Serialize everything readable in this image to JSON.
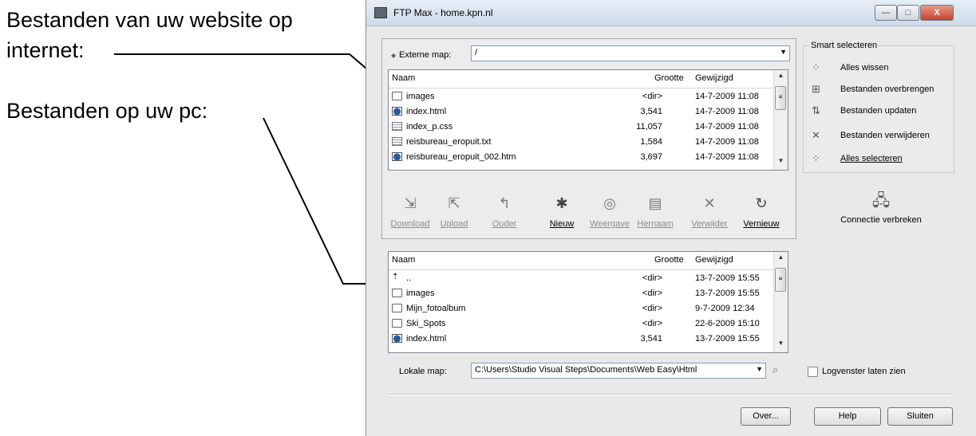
{
  "annotations": {
    "remote_line1": "Bestanden van uw website op",
    "remote_line2": "internet:",
    "local_label": "Bestanden op uw pc:"
  },
  "window": {
    "title": "FTP Max - home.kpn.nl",
    "minimize_glyph": "—",
    "maximize_glyph": "□",
    "close_glyph": "X"
  },
  "remote": {
    "map_label": "Externe map:",
    "map_value": "/",
    "columns": {
      "name": "Naam",
      "size": "Grootte",
      "modified": "Gewijzigd"
    },
    "files": [
      {
        "icon": "folder-icon",
        "name": "images",
        "size": "<dir>",
        "modified": "14-7-2009 11:08"
      },
      {
        "icon": "html-file-icon",
        "name": "index.html",
        "size": "3,541",
        "modified": "14-7-2009 11:08"
      },
      {
        "icon": "css-file-icon",
        "name": "index_p.css",
        "size": "11,057",
        "modified": "14-7-2009 11:08"
      },
      {
        "icon": "text-file-icon",
        "name": "reisbureau_eropuit.txt",
        "size": "1,584",
        "modified": "14-7-2009 11:08"
      },
      {
        "icon": "html-file-icon",
        "name": "reisbureau_eropuit_002.htm",
        "size": "3,697",
        "modified": "14-7-2009 11:08"
      }
    ]
  },
  "toolbar": {
    "download": "Download",
    "upload": "Upload",
    "parent": "Ouder",
    "new": "Nieuw",
    "view": "Weergave",
    "rename": "Hernaam",
    "delete": "Verwijder",
    "refresh": "Vernieuw"
  },
  "smart": {
    "title": "Smart selecteren",
    "items": [
      "Alles wissen",
      "Bestanden overbrengen",
      "Bestanden updaten",
      "Bestanden verwijderen",
      "Alles selecteren"
    ],
    "disconnect": "Connectie verbreken"
  },
  "local": {
    "columns": {
      "name": "Naam",
      "size": "Grootte",
      "modified": "Gewijzigd"
    },
    "files": [
      {
        "icon": "parent-folder-icon",
        "name": "..",
        "size": "<dir>",
        "modified": "13-7-2009 15:55"
      },
      {
        "icon": "folder-icon",
        "name": "images",
        "size": "<dir>",
        "modified": "13-7-2009 15:55"
      },
      {
        "icon": "folder-icon",
        "name": "Mijn_fotoalbum",
        "size": "<dir>",
        "modified": "9-7-2009 12:34"
      },
      {
        "icon": "folder-icon",
        "name": "Ski_Spots",
        "size": "<dir>",
        "modified": "22-6-2009 15:10"
      },
      {
        "icon": "html-file-icon",
        "name": "index.html",
        "size": "3,541",
        "modified": "13-7-2009 15:55"
      }
    ],
    "map_label": "Lokale map:",
    "map_value": "C:\\Users\\Studio Visual Steps\\Documents\\Web Easy\\Html"
  },
  "log_checkbox_label": "Logvenster laten zien",
  "buttons": {
    "about": "Over...",
    "help": "Help",
    "close": "Sluiten"
  }
}
